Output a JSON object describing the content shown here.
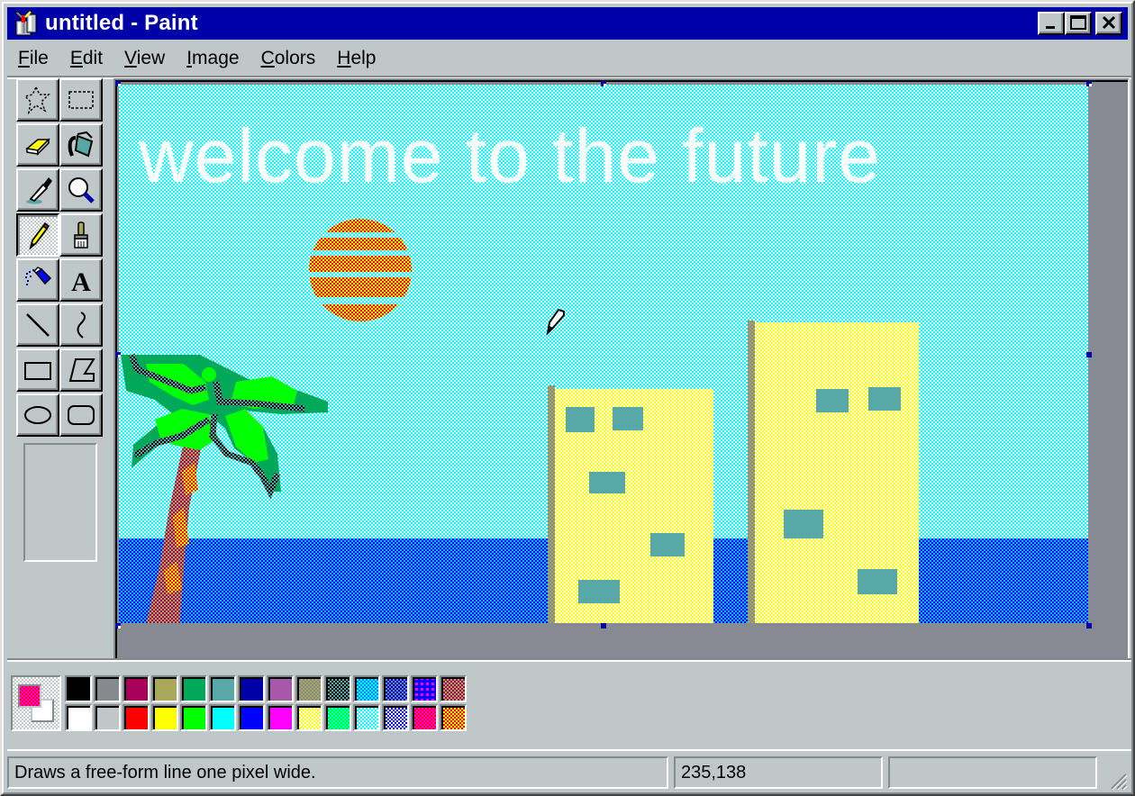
{
  "window": {
    "title": "untitled - Paint",
    "app_icon": "paint-icon",
    "controls": {
      "minimize": "minimize-icon",
      "maximize": "maximize-icon",
      "close": "close-icon"
    }
  },
  "menu": [
    {
      "label": "File",
      "accel": "F",
      "rest": "ile"
    },
    {
      "label": "Edit",
      "accel": "E",
      "rest": "dit"
    },
    {
      "label": "View",
      "accel": "V",
      "rest": "iew"
    },
    {
      "label": "Image",
      "accel": "I",
      "rest": "mage"
    },
    {
      "label": "Colors",
      "accel": "C",
      "rest": "olors"
    },
    {
      "label": "Help",
      "accel": "H",
      "rest": "elp"
    }
  ],
  "tools": [
    {
      "name": "free-form-select",
      "icon": "free-form-select-icon",
      "active": false
    },
    {
      "name": "select",
      "icon": "rect-select-icon",
      "active": false
    },
    {
      "name": "eraser",
      "icon": "eraser-icon",
      "active": false
    },
    {
      "name": "fill-with-color",
      "icon": "paint-bucket-icon",
      "active": false
    },
    {
      "name": "pick-color",
      "icon": "eyedropper-icon",
      "active": false
    },
    {
      "name": "magnifier",
      "icon": "magnifier-icon",
      "active": false
    },
    {
      "name": "pencil",
      "icon": "pencil-icon",
      "active": true
    },
    {
      "name": "brush",
      "icon": "brush-icon",
      "active": false
    },
    {
      "name": "airbrush",
      "icon": "airbrush-icon",
      "active": false
    },
    {
      "name": "text",
      "icon": "text-icon",
      "active": false
    },
    {
      "name": "line",
      "icon": "line-icon",
      "active": false
    },
    {
      "name": "curve",
      "icon": "curve-icon",
      "active": false
    },
    {
      "name": "rectangle",
      "icon": "rectangle-icon",
      "active": false
    },
    {
      "name": "polygon",
      "icon": "polygon-icon",
      "active": false
    },
    {
      "name": "ellipse",
      "icon": "ellipse-icon",
      "active": false
    },
    {
      "name": "rounded-rectangle",
      "icon": "rounded-rectangle-icon",
      "active": false
    }
  ],
  "canvas": {
    "text": "welcome to the future",
    "sky_color": "#00ffff",
    "sea_color": "#0000ff",
    "building_color": "#ffff00",
    "window_color": "#58a8a8"
  },
  "colors": {
    "foreground": {
      "a": "#ff0000",
      "b": "#ff00ff",
      "dither": true
    },
    "background": "#ffffff",
    "palette_top": [
      {
        "a": "#000000"
      },
      {
        "a": "#868a8e"
      },
      {
        "a": "#a8005a"
      },
      {
        "a": "#a8a85a"
      },
      {
        "a": "#00a85a"
      },
      {
        "a": "#58a8a8"
      },
      {
        "a": "#0000a8"
      },
      {
        "a": "#a858a8"
      },
      {
        "a": "#a8a85a",
        "b": "#868a8e",
        "dither": true
      },
      {
        "a": "#000000",
        "b": "#58a8a8",
        "dither": true
      },
      {
        "a": "#0080ff",
        "b": "#00ffff",
        "dither": true
      },
      {
        "a": "#0000a8",
        "b": "#5888c8",
        "dither": true
      },
      {
        "a": "#0000ff",
        "b": "#ff00ff",
        "dither": true,
        "grid": true
      },
      {
        "a": "#a8005a",
        "b": "#a8a85a",
        "dither": true
      }
    ],
    "palette_bottom": [
      {
        "a": "#ffffff"
      },
      {
        "a": "#c0c7c8"
      },
      {
        "a": "#ff0000"
      },
      {
        "a": "#ffff00"
      },
      {
        "a": "#00ff00"
      },
      {
        "a": "#00ffff"
      },
      {
        "a": "#0000ff"
      },
      {
        "a": "#ff00ff"
      },
      {
        "a": "#ffff00",
        "b": "#ffffff",
        "dither": true
      },
      {
        "a": "#00ff00",
        "b": "#00ffff",
        "dither": true
      },
      {
        "a": "#00ffff",
        "b": "#ffffff",
        "dither": true
      },
      {
        "a": "#0000ff",
        "b": "#ffffff",
        "dither": true
      },
      {
        "a": "#ff0000",
        "b": "#ff00ff",
        "dither": true
      },
      {
        "a": "#ff0000",
        "b": "#ffff00",
        "dither": true
      }
    ]
  },
  "status": {
    "help_text": "Draws a free-form line one pixel wide.",
    "coordinates": "235,138",
    "selection_size": ""
  }
}
